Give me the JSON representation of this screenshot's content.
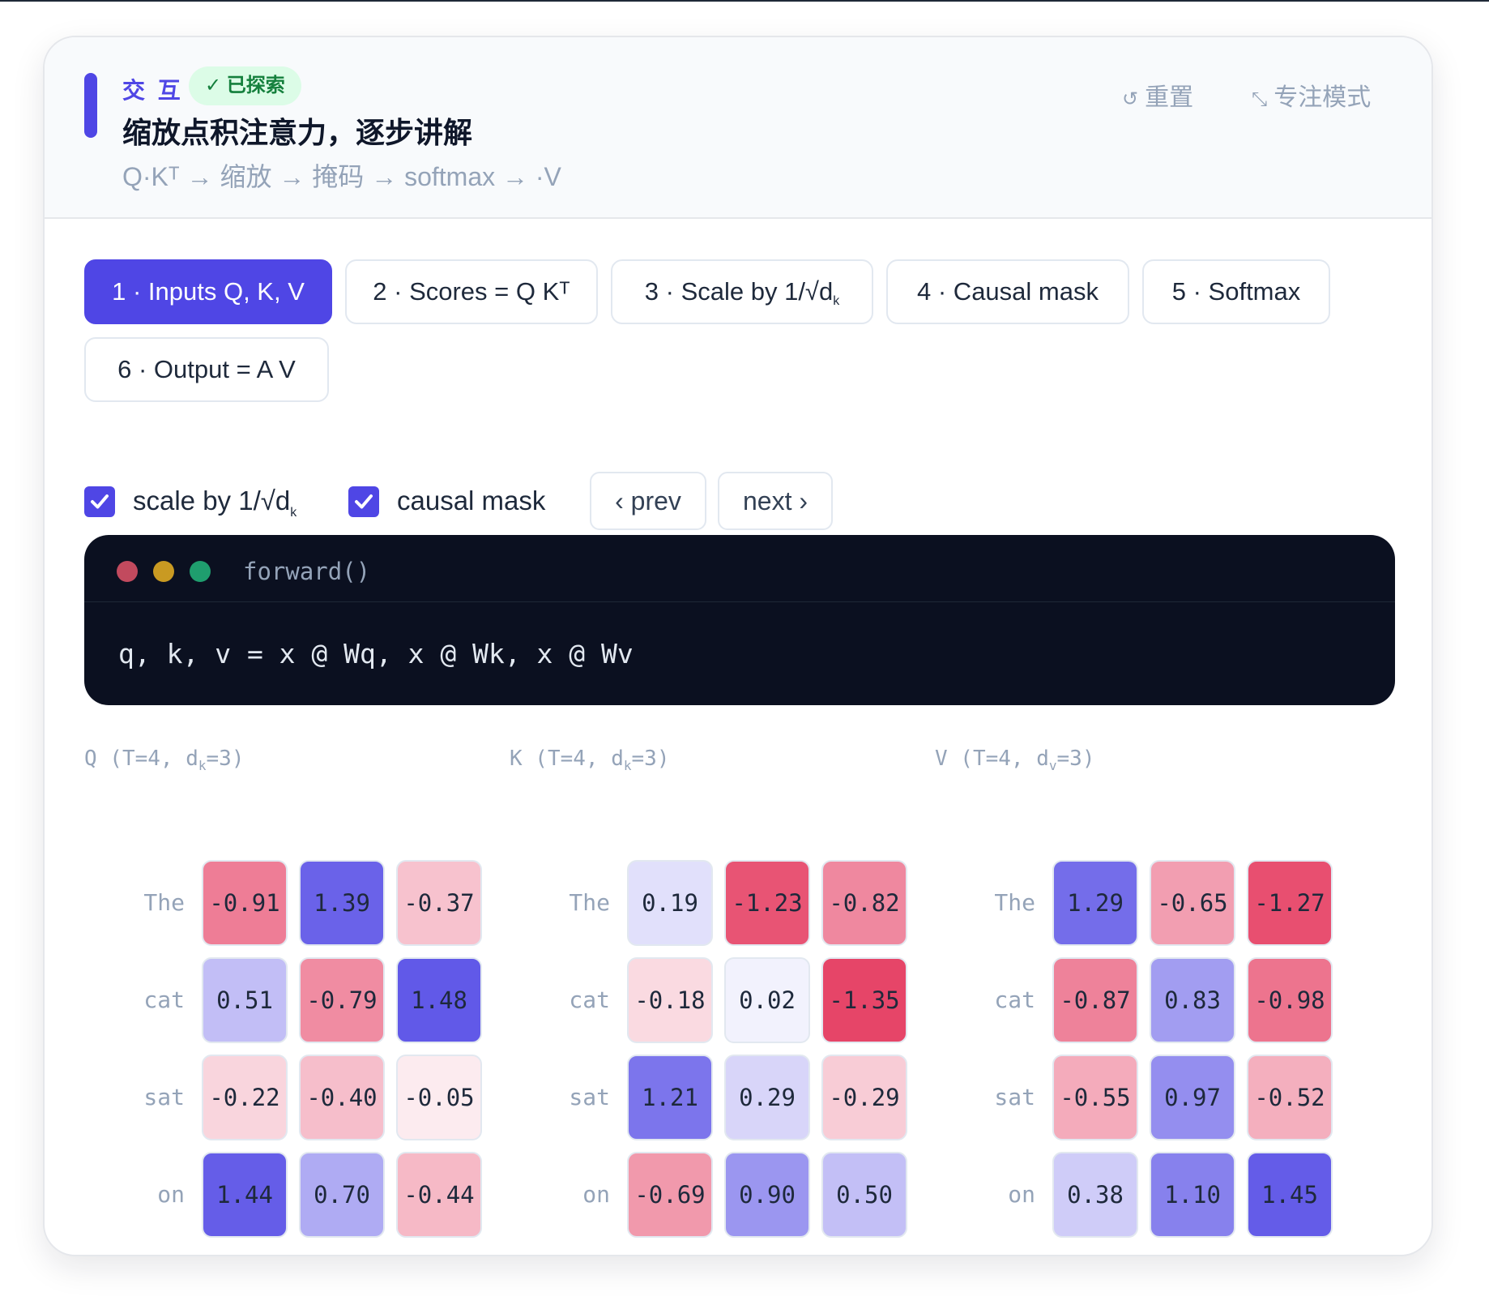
{
  "header": {
    "kicker": "交 互",
    "explored_badge": "✓ 已探索",
    "title": "缩放点积注意力，逐步讲解",
    "subtitle": "Q·Kᵀ → 缩放 → 掩码 → softmax → ·V",
    "reset_label": "重置",
    "focus_label": "专注模式"
  },
  "steps": [
    {
      "label": "1 · Inputs Q, K, V",
      "active": true
    },
    {
      "label": "2 · Scores = Q Kᵀ",
      "active": false
    },
    {
      "label": "3 · Scale by 1/√d",
      "sub": "k",
      "active": false
    },
    {
      "label": "4 · Causal mask",
      "active": false
    },
    {
      "label": "5 · Softmax",
      "active": false
    },
    {
      "label": "6 · Output = A V",
      "active": false
    }
  ],
  "controls": {
    "scale_label": "scale by 1/√d",
    "scale_sub": "k",
    "scale_checked": true,
    "causal_label": "causal mask",
    "causal_checked": true,
    "prev_label": "‹ prev",
    "next_label": "next ›"
  },
  "code": {
    "title": "forward()",
    "line": "q, k, v = x @ Wq, x @ Wk, x @ Wv"
  },
  "colors": {
    "accent": "#4f46e5",
    "positive": "#4f46e5",
    "negative": "#e11d48",
    "dot_red": "#c24a5e",
    "dot_yellow": "#c99a22",
    "dot_green": "#1f9e6e"
  },
  "tokens": [
    "The",
    "cat",
    "sat",
    "on"
  ],
  "matrices": [
    {
      "label_main": "Q (T=4, d",
      "label_sub": "k",
      "label_end": "=3)",
      "values": [
        [
          -0.91,
          1.39,
          -0.37
        ],
        [
          0.51,
          -0.79,
          1.48
        ],
        [
          -0.22,
          -0.4,
          -0.05
        ],
        [
          1.44,
          0.7,
          -0.44
        ]
      ],
      "display": [
        [
          "-0.91",
          "1.39",
          "-0.37"
        ],
        [
          "0.51",
          "-0.79",
          "1.48"
        ],
        [
          "-0.22",
          "-0.40",
          "-0.05"
        ],
        [
          "1.44",
          "0.70",
          "-0.44"
        ]
      ]
    },
    {
      "label_main": "K (T=4, d",
      "label_sub": "k",
      "label_end": "=3)",
      "values": [
        [
          0.19,
          -1.23,
          -0.82
        ],
        [
          -0.18,
          0.02,
          -1.35
        ],
        [
          1.21,
          0.29,
          -0.29
        ],
        [
          -0.69,
          0.9,
          0.5
        ]
      ],
      "display": [
        [
          "0.19",
          "-1.23",
          "-0.82"
        ],
        [
          "-0.18",
          "0.02",
          "-1.35"
        ],
        [
          "1.21",
          "0.29",
          "-0.29"
        ],
        [
          "-0.69",
          "0.90",
          "0.50"
        ]
      ]
    },
    {
      "label_main": "V (T=4, d",
      "label_sub": "v",
      "label_end": "=3)",
      "values": [
        [
          1.29,
          -0.65,
          -1.27
        ],
        [
          -0.87,
          0.83,
          -0.98
        ],
        [
          -0.55,
          0.97,
          -0.52
        ],
        [
          0.38,
          1.1,
          1.45
        ]
      ],
      "display": [
        [
          "1.29",
          "-0.65",
          "-1.27"
        ],
        [
          "-0.87",
          "0.83",
          "-0.98"
        ],
        [
          "-0.55",
          "0.97",
          "-0.52"
        ],
        [
          "0.38",
          "1.10",
          "1.45"
        ]
      ]
    }
  ]
}
